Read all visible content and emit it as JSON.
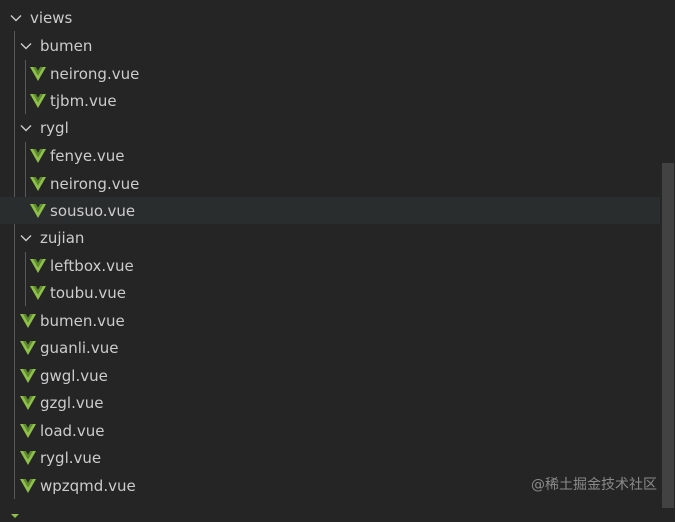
{
  "explorer": {
    "root_folder": "views",
    "folders": [
      {
        "name": "bumen",
        "files": [
          "neirong.vue",
          "tjbm.vue"
        ]
      },
      {
        "name": "rygl",
        "files": [
          "fenye.vue",
          "neirong.vue",
          "sousuo.vue"
        ]
      },
      {
        "name": "zujian",
        "files": [
          "leftbox.vue",
          "toubu.vue"
        ]
      }
    ],
    "root_files": [
      "bumen.vue",
      "guanli.vue",
      "gwgl.vue",
      "gzgl.vue",
      "load.vue",
      "rygl.vue",
      "wpzqmd.vue"
    ],
    "hovered_file": "rygl/sousuo.vue"
  },
  "watermark": "@稀土掘金技术社区",
  "colors": {
    "background": "#252526",
    "text": "#cccccc",
    "vue_green": "#8dc149",
    "hover_row": "#2a2d2e",
    "indent_guide": "#585858",
    "scrollbar_thumb": "#424242"
  }
}
